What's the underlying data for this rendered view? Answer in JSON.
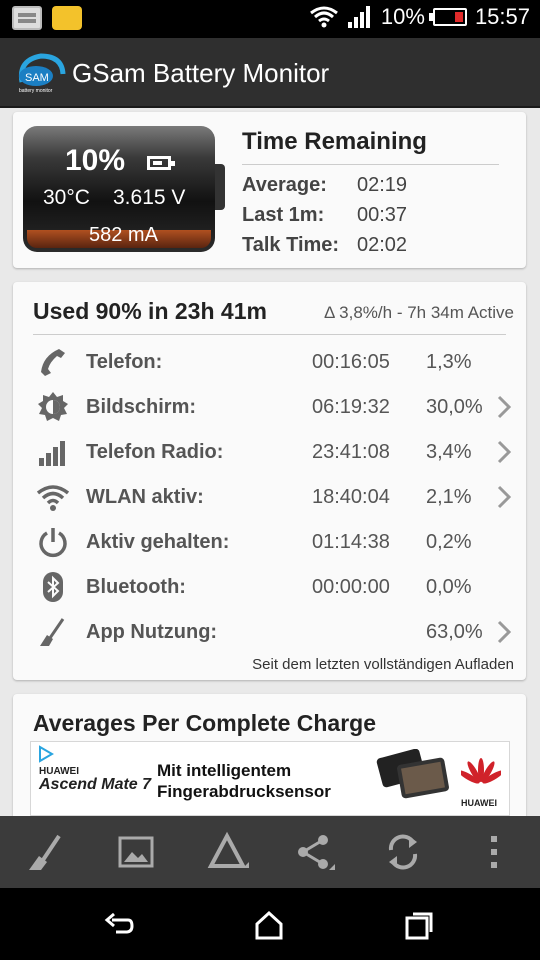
{
  "status_bar": {
    "battery_pct": "10%",
    "time": "15:57"
  },
  "app_bar": {
    "title": "GSam Battery Monitor",
    "logo_text": "SAM",
    "logo_sub": "battery monitor"
  },
  "battery": {
    "percent": "10%",
    "temperature": "30°C",
    "voltage": "3.615 V",
    "current": "582 mA",
    "level": 0.1
  },
  "time_remaining": {
    "title": "Time Remaining",
    "rows": [
      {
        "label": "Average:",
        "value": "02:19"
      },
      {
        "label": "Last 1m:",
        "value": "00:37"
      },
      {
        "label": "Talk Time:",
        "value": "02:02"
      }
    ]
  },
  "usage": {
    "title": "Used 90% in 23h 41m",
    "rate": "Δ 3,8%/h - 7h 34m Active",
    "rows": [
      {
        "icon": "phone-icon",
        "name": "Telefon:",
        "time": "00:16:05",
        "pct": "1,3%",
        "chevron": false
      },
      {
        "icon": "brightness-icon",
        "name": "Bildschirm:",
        "time": "06:19:32",
        "pct": "30,0%",
        "chevron": true
      },
      {
        "icon": "signal-bars-icon",
        "name": "Telefon Radio:",
        "time": "23:41:08",
        "pct": "3,4%",
        "chevron": true
      },
      {
        "icon": "wifi-icon",
        "name": "WLAN aktiv:",
        "time": "18:40:04",
        "pct": "2,1%",
        "chevron": true
      },
      {
        "icon": "power-icon",
        "name": "Aktiv gehalten:",
        "time": "01:14:38",
        "pct": "0,2%",
        "chevron": false
      },
      {
        "icon": "bluetooth-icon",
        "name": "Bluetooth:",
        "time": "00:00:00",
        "pct": "0,0%",
        "chevron": false
      },
      {
        "icon": "broom-icon",
        "name": "App Nutzung:",
        "time": "",
        "pct": "63,0%",
        "chevron": true
      }
    ],
    "footer": "Seit dem letzten vollständigen Aufladen"
  },
  "averages": {
    "title": "Averages Per Complete Charge"
  },
  "ad": {
    "brand": "HUAWEI",
    "model": "Ascend Mate 7",
    "line1": "Mit intelligentem",
    "line2": "Fingerabdrucksensor",
    "logo_text": "HUAWEI"
  },
  "colors": {
    "accent_orange": "#b05020",
    "toolbar": "#3b3b3b",
    "appbar": "#2f2f2f"
  }
}
